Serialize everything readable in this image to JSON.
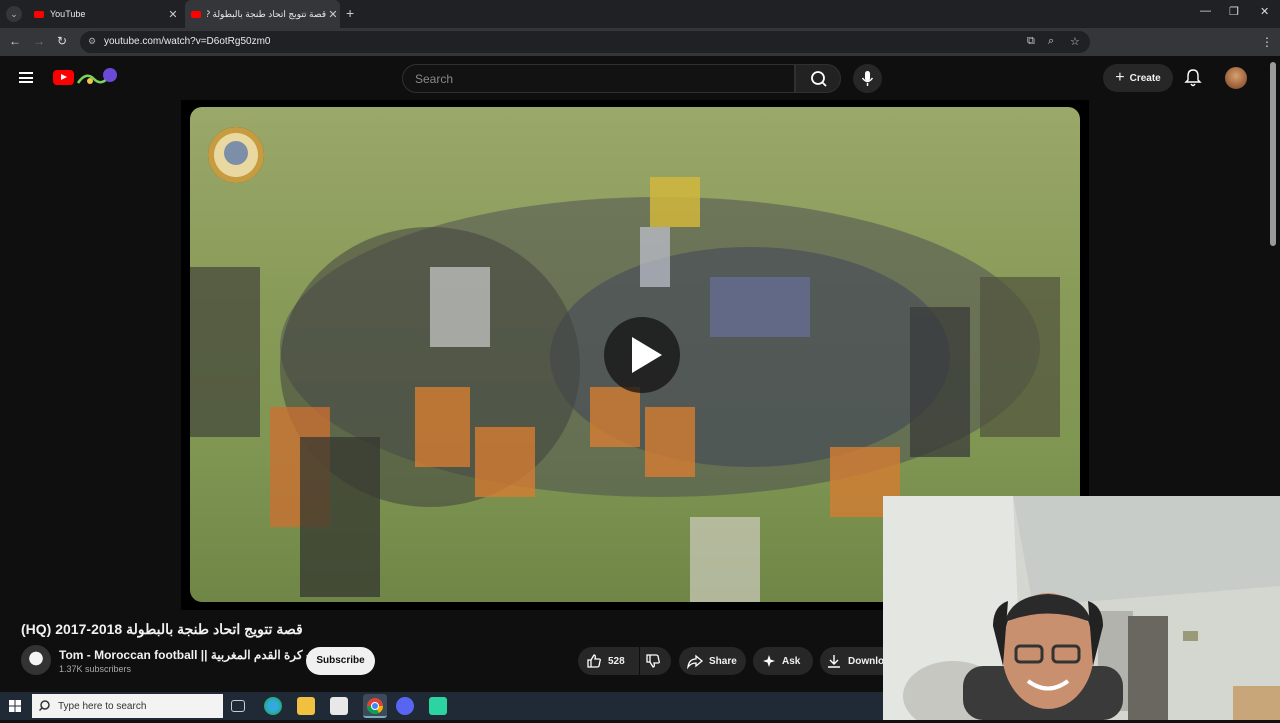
{
  "browser": {
    "tabs": [
      {
        "label": "YouTube"
      },
      {
        "label": "قصة تتويج اتحاد طنجة بالبطولة ?"
      }
    ],
    "url": "youtube.com/watch?v=D6otRg50zm0"
  },
  "header": {
    "search_placeholder": "Search",
    "create_label": "Create"
  },
  "video": {
    "title": "قصة تتويج اتحاد طنجة بالبطولة 2018-2017 (HQ)",
    "channel_name": "Tom - Moroccan football || طوم- كرة القدم المغربية",
    "subscribers": "1.37K subscribers",
    "subscribe_label": "Subscribe",
    "likes": "528",
    "share_label": "Share",
    "ask_label": "Ask",
    "download_label": "Download"
  },
  "taskbar": {
    "search_placeholder": "Type here to search"
  },
  "colors": {
    "brand_red": "#ff0000",
    "background": "#0f0f0f",
    "pitch_green": "#889a58"
  }
}
